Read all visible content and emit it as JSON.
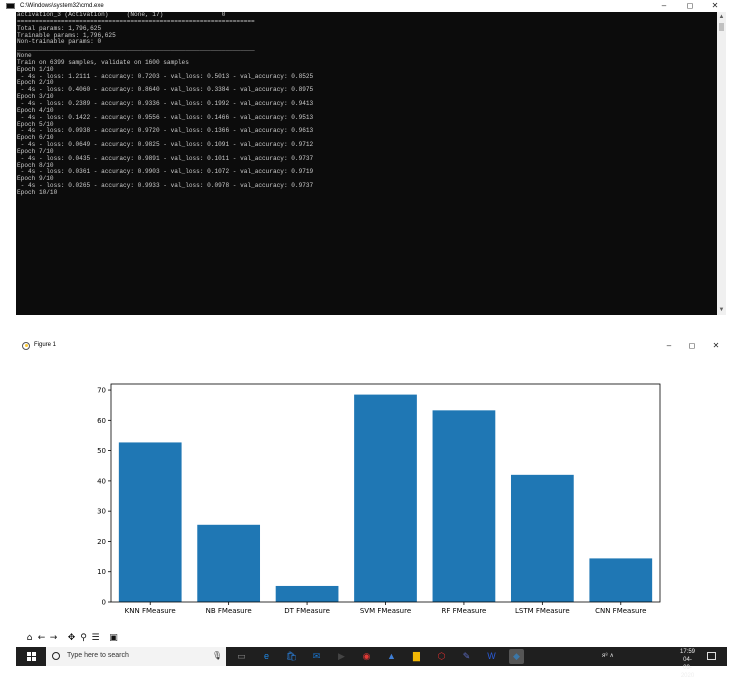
{
  "cmd_window": {
    "title": "C:\\Windows\\system32\\cmd.exe",
    "controls": {
      "minimize": "–",
      "maximize": "◻",
      "close": "✕"
    },
    "lines": [
      "activation_3 (Activation)     (None, 17)                0",
      "=================================================================",
      "Total params: 1,796,625",
      "Trainable params: 1,796,625",
      "Non-trainable params: 0",
      "_________________________________________________________________",
      "None",
      "Train on 6399 samples, validate on 1600 samples",
      "Epoch 1/10",
      " - 4s - loss: 1.2111 - accuracy: 0.7203 - val_loss: 0.5013 - val_accuracy: 0.8525",
      "Epoch 2/10",
      " - 4s - loss: 0.4060 - accuracy: 0.8640 - val_loss: 0.3384 - val_accuracy: 0.8975",
      "Epoch 3/10",
      " - 4s - loss: 0.2389 - accuracy: 0.9336 - val_loss: 0.1992 - val_accuracy: 0.9413",
      "Epoch 4/10",
      " - 4s - loss: 0.1422 - accuracy: 0.9556 - val_loss: 0.1466 - val_accuracy: 0.9513",
      "Epoch 5/10",
      " - 4s - loss: 0.0938 - accuracy: 0.9720 - val_loss: 0.1366 - val_accuracy: 0.9613",
      "Epoch 6/10",
      " - 4s - loss: 0.0649 - accuracy: 0.9825 - val_loss: 0.1091 - val_accuracy: 0.9712",
      "Epoch 7/10",
      " - 4s - loss: 0.0435 - accuracy: 0.9891 - val_loss: 0.1011 - val_accuracy: 0.9737",
      "Epoch 8/10",
      " - 4s - loss: 0.0361 - accuracy: 0.9903 - val_loss: 0.1072 - val_accuracy: 0.9719",
      "Epoch 9/10",
      " - 4s - loss: 0.0265 - accuracy: 0.9933 - val_loss: 0.0978 - val_accuracy: 0.9737",
      "Epoch 10/10"
    ]
  },
  "figure_window": {
    "title": "Figure 1",
    "controls": {
      "minimize": "–",
      "maximize": "◻",
      "close": "✕"
    },
    "toolbar": [
      {
        "name": "home-icon",
        "glyph": "⌂"
      },
      {
        "name": "back-arrow-icon",
        "glyph": "←"
      },
      {
        "name": "forward-arrow-icon",
        "glyph": "→"
      },
      {
        "name": "pan-icon",
        "glyph": "✥"
      },
      {
        "name": "zoom-icon",
        "glyph": "⚲"
      },
      {
        "name": "configure-subplots-icon",
        "glyph": "☰"
      },
      {
        "name": "save-icon",
        "glyph": "▣"
      }
    ]
  },
  "chart_data": {
    "type": "bar",
    "categories": [
      "KNN FMeasure",
      "NB FMeasure",
      "DT FMeasure",
      "SVM FMeasure",
      "RF FMeasure",
      "LSTM FMeasure",
      "CNN FMeasure"
    ],
    "values": [
      52.7,
      25.5,
      5.3,
      68.5,
      63.3,
      42.0,
      14.4
    ],
    "title": "",
    "xlabel": "",
    "ylabel": "",
    "ylim": [
      0,
      72
    ],
    "yticks": [
      0,
      10,
      20,
      30,
      40,
      50,
      60,
      70
    ],
    "grid": false,
    "bar_color": "#1f77b4"
  },
  "taskbar": {
    "search_placeholder": "Type here to search",
    "apps": [
      "task-view-icon",
      "edge-icon",
      "store-icon",
      "mail-icon",
      "video-icon",
      "chrome-icon",
      "photos-icon",
      "files-icon",
      "pdf-icon",
      "app-icon",
      "word-icon",
      "python-icon"
    ],
    "tray_text": "ᴙ⁸  ∧",
    "time": "17:59",
    "date": "04-09-2020"
  }
}
